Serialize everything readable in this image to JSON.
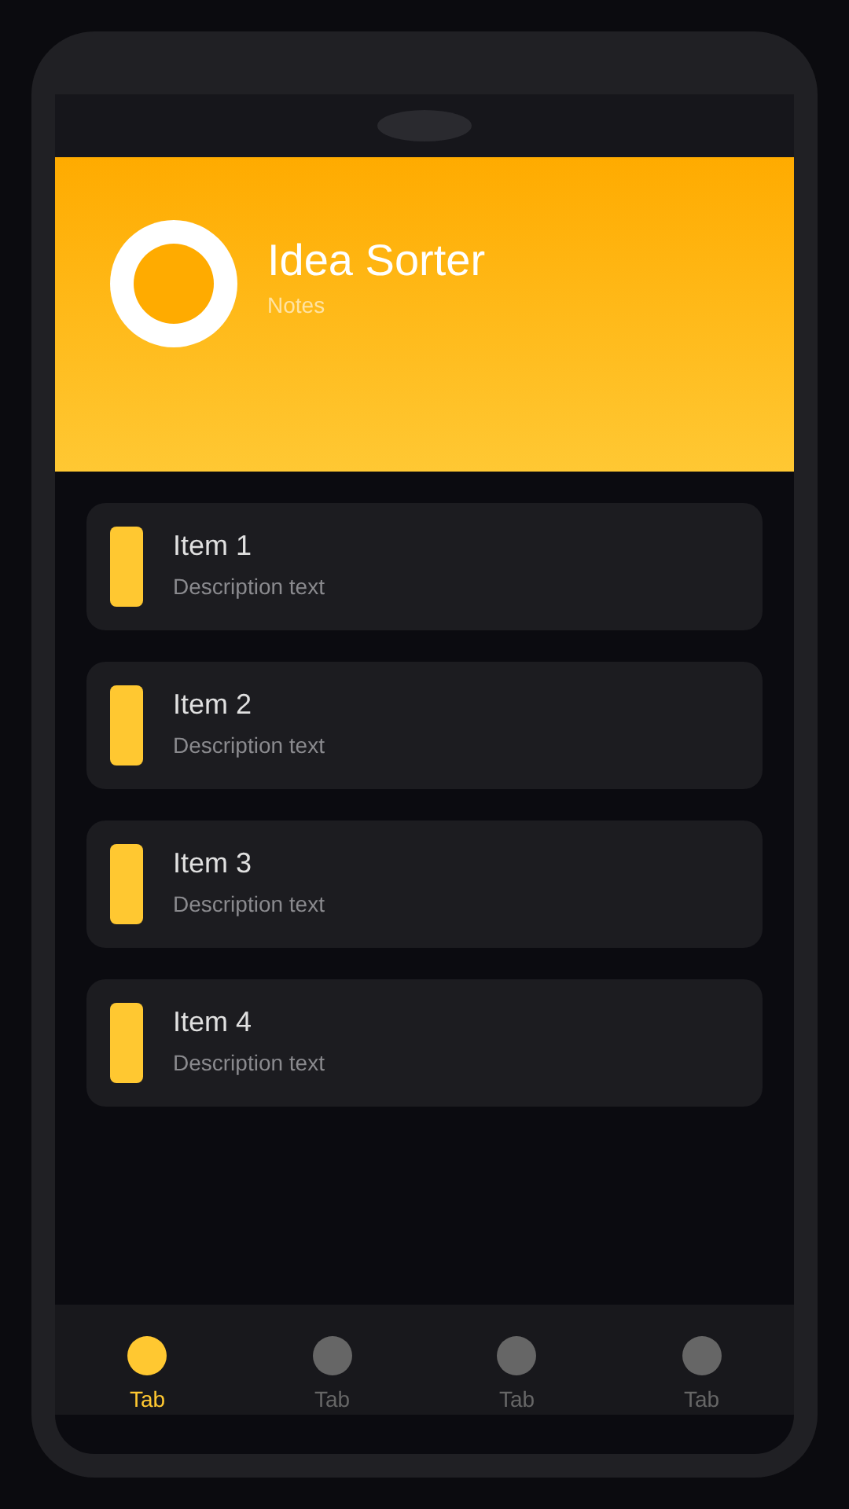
{
  "header": {
    "title": "Idea Sorter",
    "subtitle": "Notes"
  },
  "items": [
    {
      "title": "Item 1",
      "description": "Description text"
    },
    {
      "title": "Item 2",
      "description": "Description text"
    },
    {
      "title": "Item 3",
      "description": "Description text"
    },
    {
      "title": "Item 4",
      "description": "Description text"
    }
  ],
  "tabs": [
    {
      "label": "Tab",
      "selected": true
    },
    {
      "label": "Tab",
      "selected": false
    },
    {
      "label": "Tab",
      "selected": false
    },
    {
      "label": "Tab",
      "selected": false
    }
  ]
}
